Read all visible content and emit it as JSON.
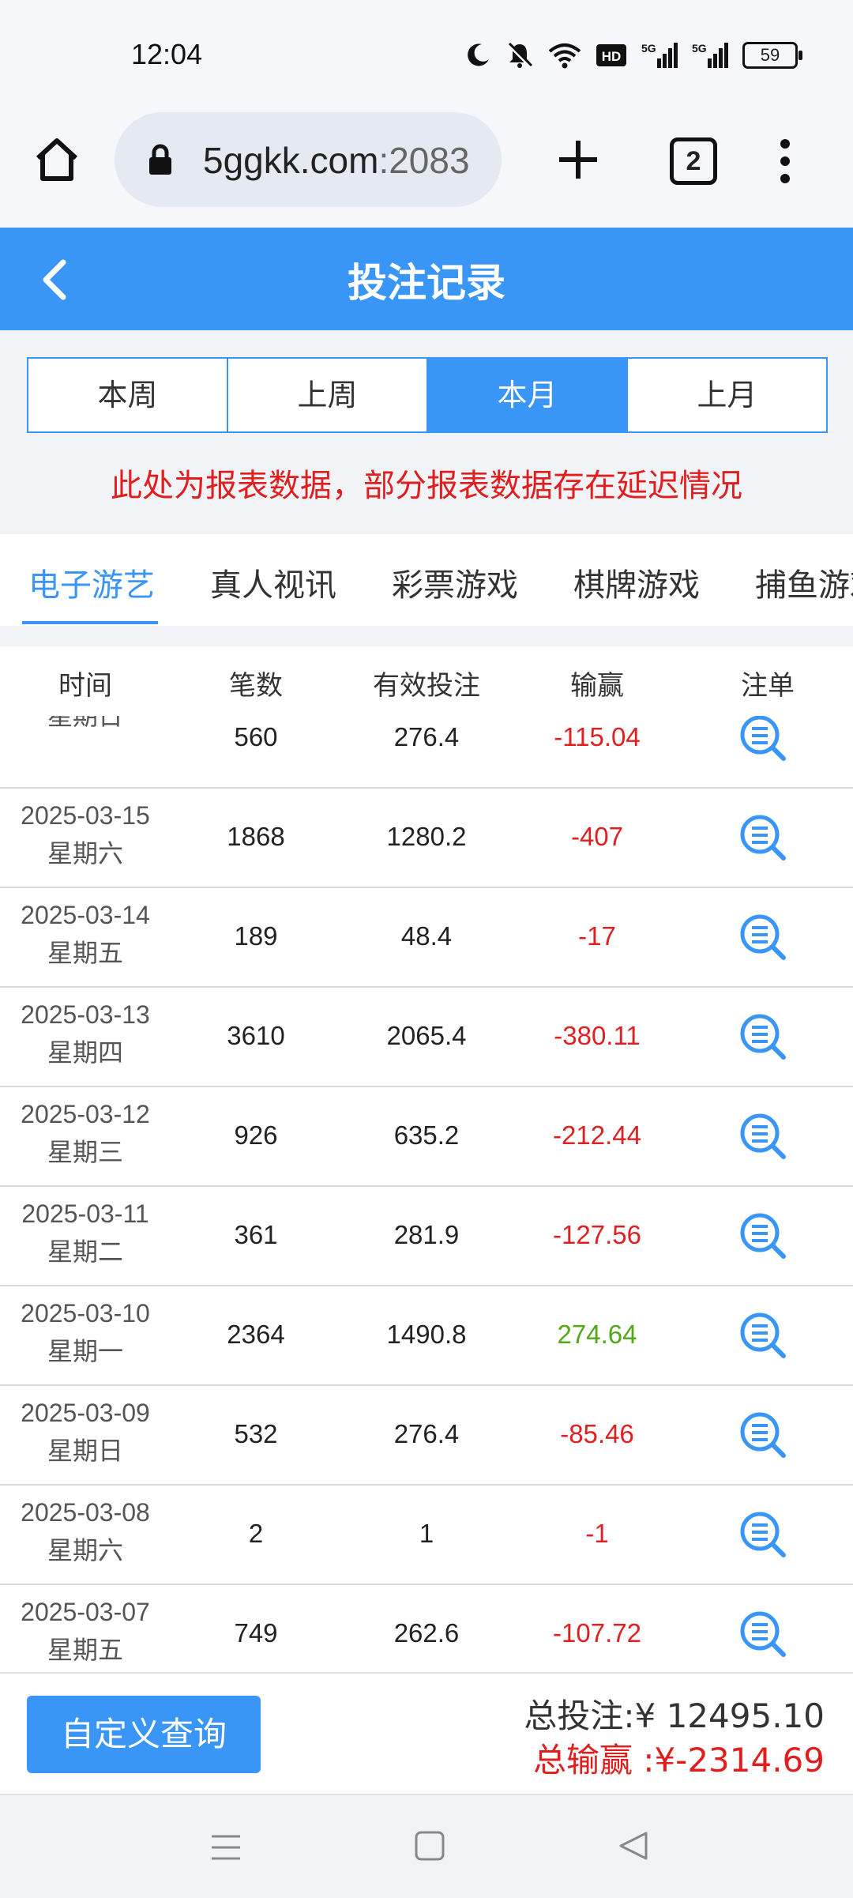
{
  "status_bar": {
    "time": "12:04",
    "network_1": "5G",
    "network_2": "5G",
    "battery": "59"
  },
  "browser": {
    "url_host": "5ggkk.com",
    "url_port": ":2083",
    "tab_count": "2"
  },
  "header": {
    "title": "投注记录"
  },
  "period_tabs": [
    {
      "label": "本周",
      "active": false
    },
    {
      "label": "上周",
      "active": false
    },
    {
      "label": "本月",
      "active": true
    },
    {
      "label": "上月",
      "active": false
    }
  ],
  "notice": "此处为报表数据，部分报表数据存在延迟情况",
  "category_tabs": [
    {
      "label": "电子游艺",
      "active": true
    },
    {
      "label": "真人视讯",
      "active": false
    },
    {
      "label": "彩票游戏",
      "active": false
    },
    {
      "label": "棋牌游戏",
      "active": false
    },
    {
      "label": "捕鱼游戏",
      "active": false
    }
  ],
  "table": {
    "columns": [
      "时间",
      "笔数",
      "有效投注",
      "输赢",
      "注单"
    ],
    "rows": [
      {
        "date": "",
        "weekday": "星期日",
        "count": "560",
        "bet": "276.4",
        "win": "-115.04"
      },
      {
        "date": "2025-03-15",
        "weekday": "星期六",
        "count": "1868",
        "bet": "1280.2",
        "win": "-407"
      },
      {
        "date": "2025-03-14",
        "weekday": "星期五",
        "count": "189",
        "bet": "48.4",
        "win": "-17"
      },
      {
        "date": "2025-03-13",
        "weekday": "星期四",
        "count": "3610",
        "bet": "2065.4",
        "win": "-380.11"
      },
      {
        "date": "2025-03-12",
        "weekday": "星期三",
        "count": "926",
        "bet": "635.2",
        "win": "-212.44"
      },
      {
        "date": "2025-03-11",
        "weekday": "星期二",
        "count": "361",
        "bet": "281.9",
        "win": "-127.56"
      },
      {
        "date": "2025-03-10",
        "weekday": "星期一",
        "count": "2364",
        "bet": "1490.8",
        "win": "274.64"
      },
      {
        "date": "2025-03-09",
        "weekday": "星期日",
        "count": "532",
        "bet": "276.4",
        "win": "-85.46"
      },
      {
        "date": "2025-03-08",
        "weekday": "星期六",
        "count": "2",
        "bet": "1",
        "win": "-1"
      },
      {
        "date": "2025-03-07",
        "weekday": "星期五",
        "count": "749",
        "bet": "262.6",
        "win": "-107.72"
      }
    ]
  },
  "footer": {
    "query_button": "自定义查询",
    "total_bet": "总投注:¥ 12495.10",
    "total_win": "总输赢 :¥-2314.69"
  },
  "colors": {
    "accent": "#3a96f6",
    "negative": "#e02020",
    "positive": "#52a818",
    "notice": "#e01e1e"
  }
}
